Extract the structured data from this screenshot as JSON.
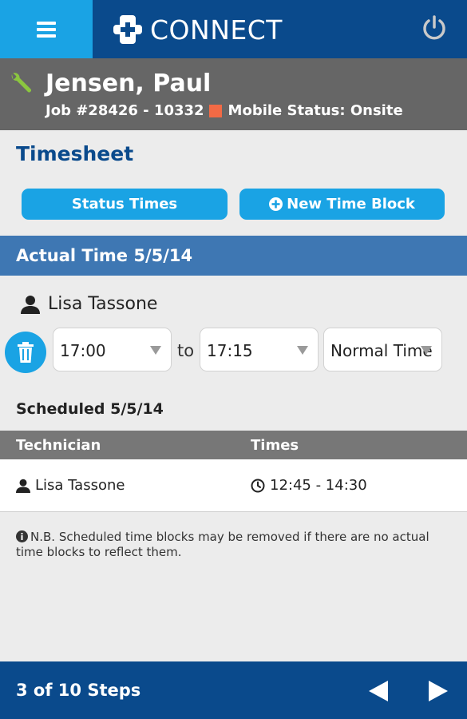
{
  "app": {
    "title": "CONNECT",
    "brand_color": "#0a4a8c",
    "accent_color": "#1aa3e4"
  },
  "topbar": {
    "menu_icon": "hamburger-menu-icon",
    "logo_icon": "plus-cross-logo-icon",
    "power_icon": "power-icon"
  },
  "job": {
    "client_name": "Jensen, Paul",
    "job_number": "Job #28426 - 10332",
    "status_label": "Mobile Status: Onsite",
    "status_color": "#f26a45",
    "icon": "wrench-icon"
  },
  "timesheet": {
    "title": "Timesheet",
    "status_times_label": "Status Times",
    "new_time_block_label": "New Time Block"
  },
  "actual": {
    "title": "Actual Time 5/5/14",
    "technician": "Lisa Tassone",
    "from_time": "17:00",
    "to_label": "to",
    "to_time": "17:15",
    "time_type": "Normal Time"
  },
  "scheduled": {
    "title": "Scheduled 5/5/14",
    "columns": [
      "Technician",
      "Times"
    ],
    "rows": [
      {
        "technician": "Lisa Tassone",
        "times": "12:45 - 14:30"
      }
    ]
  },
  "note": {
    "text": "N.B. Scheduled time blocks may be removed if there are no actual time blocks to reflect them."
  },
  "footer": {
    "steps": "3 of 10 Steps"
  }
}
